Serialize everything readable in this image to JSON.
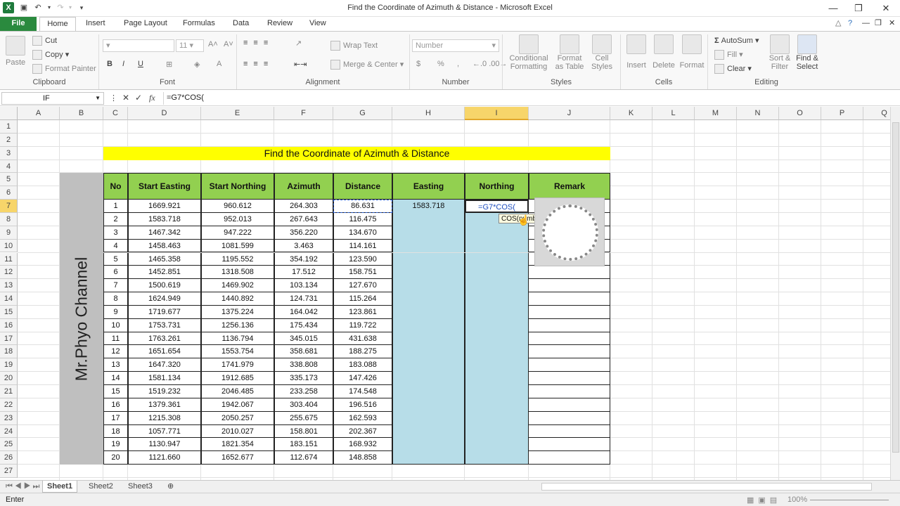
{
  "window": {
    "title": "Find the Coordinate of Azimuth & Distance  -  Microsoft Excel",
    "min": "—",
    "restore": "❐",
    "close": "✕"
  },
  "tabs": [
    "File",
    "Home",
    "Insert",
    "Page Layout",
    "Formulas",
    "Data",
    "Review",
    "View"
  ],
  "clipboard": {
    "paste": "Paste",
    "cut": "Cut",
    "copy": "Copy",
    "format_painter": "Format Painter",
    "label": "Clipboard"
  },
  "font": {
    "size": "11",
    "bold": "B",
    "italic": "I",
    "underline": "U",
    "label": "Font"
  },
  "alignment": {
    "wrap_text": "Wrap Text",
    "merge_center": "Merge & Center",
    "label": "Alignment"
  },
  "number": {
    "format": "Number",
    "currency": "$",
    "percent": "%",
    "comma": ",",
    "label": "Number"
  },
  "styles": {
    "conditional": "Conditional",
    "formatting": "Formatting",
    "format": "Format",
    "as_table": "as Table",
    "cell": "Cell",
    "cell_styles": "Styles",
    "label": "Styles"
  },
  "cells": {
    "insert": "Insert",
    "delete": "Delete",
    "format": "Format",
    "label": "Cells"
  },
  "editing": {
    "autosum": "AutoSum",
    "fill": "Fill",
    "clear": "Clear",
    "sort": "Sort &",
    "filter": "Filter",
    "find": "Find &",
    "select": "Select",
    "label": "Editing"
  },
  "formula_bar": {
    "name_box": "IF",
    "cancel": "✕",
    "enter": "✓",
    "fx": "fx",
    "formula": "=G7*COS("
  },
  "columns": [
    "A",
    "B",
    "C",
    "D",
    "E",
    "F",
    "G",
    "H",
    "I",
    "J",
    "K",
    "L",
    "M",
    "N",
    "O",
    "P",
    "Q"
  ],
  "rows": [
    "1",
    "2",
    "3",
    "4",
    "5",
    "6",
    "7",
    "8",
    "9",
    "10",
    "11",
    "12",
    "13",
    "14",
    "15",
    "16",
    "17",
    "18",
    "19",
    "20",
    "21",
    "22",
    "23",
    "24",
    "25",
    "26",
    "27"
  ],
  "sheet_title": "Find the Coordinate of Azimuth & Distance",
  "side_label": "Mr.Phyo Channel",
  "table": {
    "headers": [
      "No",
      "Start Easting",
      "Start Northing",
      "Azimuth",
      "Distance",
      "Easting",
      "Northing",
      "Remark"
    ],
    "rows": [
      [
        "1",
        "1669.921",
        "960.612",
        "264.303",
        "86.631"
      ],
      [
        "2",
        "1583.718",
        "952.013",
        "267.643",
        "116.475"
      ],
      [
        "3",
        "1467.342",
        "947.222",
        "356.220",
        "134.670"
      ],
      [
        "4",
        "1458.463",
        "1081.599",
        "3.463",
        "114.161"
      ],
      [
        "5",
        "1465.358",
        "1195.552",
        "354.192",
        "123.590"
      ],
      [
        "6",
        "1452.851",
        "1318.508",
        "17.512",
        "158.751"
      ],
      [
        "7",
        "1500.619",
        "1469.902",
        "103.134",
        "127.670"
      ],
      [
        "8",
        "1624.949",
        "1440.892",
        "124.731",
        "115.264"
      ],
      [
        "9",
        "1719.677",
        "1375.224",
        "164.042",
        "123.861"
      ],
      [
        "10",
        "1753.731",
        "1256.136",
        "175.434",
        "119.722"
      ],
      [
        "11",
        "1763.261",
        "1136.794",
        "345.015",
        "431.638"
      ],
      [
        "12",
        "1651.654",
        "1553.754",
        "358.681",
        "188.275"
      ],
      [
        "13",
        "1647.320",
        "1741.979",
        "338.808",
        "183.088"
      ],
      [
        "14",
        "1581.134",
        "1912.685",
        "335.173",
        "147.426"
      ],
      [
        "15",
        "1519.232",
        "2046.485",
        "233.258",
        "174.548"
      ],
      [
        "16",
        "1379.361",
        "1942.067",
        "303.404",
        "196.516"
      ],
      [
        "17",
        "1215.308",
        "2050.257",
        "255.675",
        "162.593"
      ],
      [
        "18",
        "1057.771",
        "2010.027",
        "158.801",
        "202.367"
      ],
      [
        "19",
        "1130.947",
        "1821.354",
        "183.151",
        "168.932"
      ],
      [
        "20",
        "1121.660",
        "1652.677",
        "112.674",
        "148.858"
      ]
    ],
    "easting_first": "1583.718",
    "northing_edit": "=G7*COS(",
    "tooltip": "COS(number)"
  },
  "sheets": [
    "Sheet1",
    "Sheet2",
    "Sheet3"
  ],
  "status": {
    "mode": "Enter",
    "zoom": "100%"
  },
  "colors": {
    "file_tab": "#2a8a3e",
    "title_band": "#ffff00",
    "header_fill": "#92d050",
    "side_band": "#bfbfbf",
    "result_fill": "#b7dde8"
  }
}
